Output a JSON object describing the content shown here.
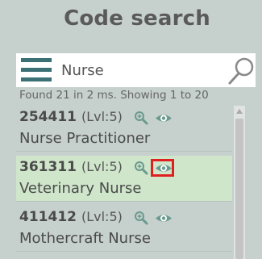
{
  "header": {
    "title": "Code search"
  },
  "search": {
    "value": "Nurse",
    "placeholder": ""
  },
  "status": {
    "text": "Found 21 in 2 ms. Showing 1 to 20"
  },
  "results": [
    {
      "code": "254411",
      "level": "(Lvl:5)",
      "name": "Nurse Practitioner",
      "selected": false
    },
    {
      "code": "361311",
      "level": "(Lvl:5)",
      "name": "Veterinary Nurse",
      "selected": true
    },
    {
      "code": "411412",
      "level": "(Lvl:5)",
      "name": "Mothercraft Nurse",
      "selected": false
    }
  ],
  "colors": {
    "background": "#c6d0cd",
    "accent": "#3b7175",
    "selected_row": "#cfe6cb",
    "highlight": "#e02020",
    "icon": "#6a9a8e"
  },
  "icons": {
    "menu": "hamburger-menu-icon",
    "search": "magnifier-icon",
    "zoom": "zoom-in-icon",
    "view": "eye-icon"
  }
}
